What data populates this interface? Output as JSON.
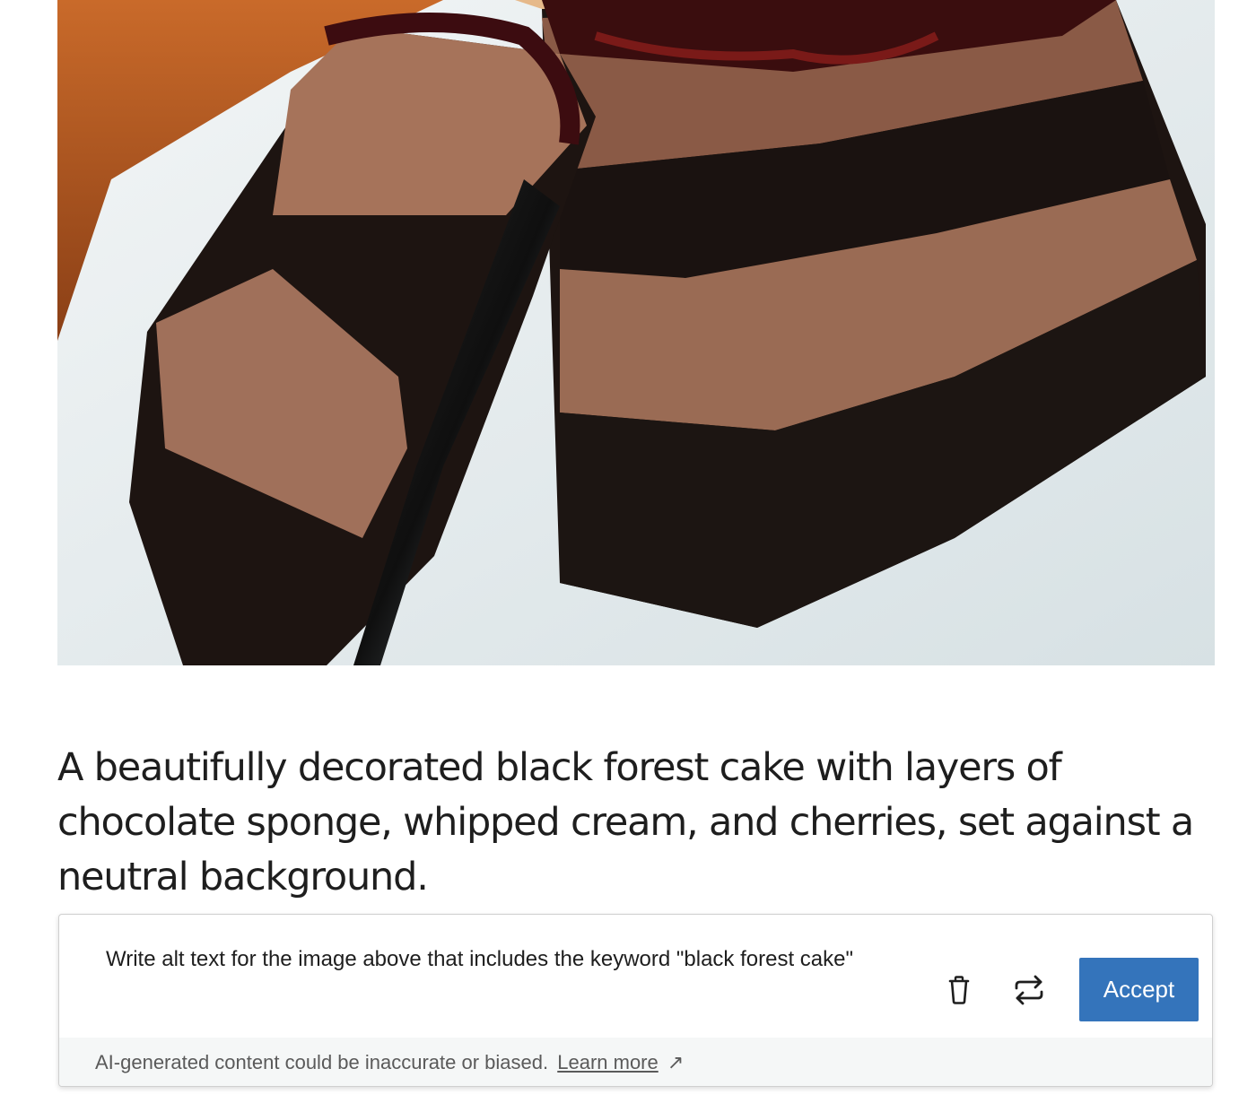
{
  "paragraph": {
    "text": "A beautifully decorated black forest cake with layers of chocolate sponge, whipped cream, and cherries, set against a neutral background."
  },
  "ai_panel": {
    "prompt": "Write alt text for the image above that includes the keyword \"black forest cake\"",
    "accept_label": "Accept",
    "disclaimer": "AI-generated content could be inaccurate or biased.",
    "learn_more_label": "Learn more",
    "learn_more_arrow": "↗"
  },
  "icons": {
    "delete": "trash-icon",
    "regenerate": "repeat-icon",
    "external_link": "arrow-up-right-icon"
  },
  "colors": {
    "accent": "#3474bb",
    "footer_bg": "#f5f7f7",
    "text": "#1e1e1e"
  }
}
